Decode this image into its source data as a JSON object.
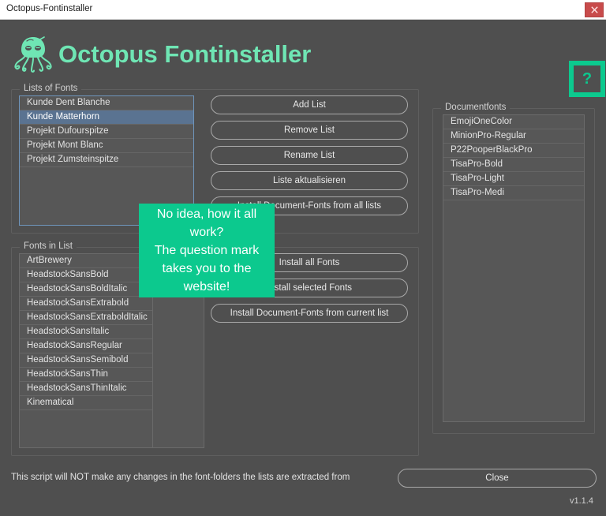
{
  "window": {
    "title": "Octopus-Fontinstaller",
    "close_icon": "close-icon"
  },
  "header": {
    "app_title": "Octopus Fontinstaller",
    "logo_icon": "octopus-logo-icon",
    "help_label": "?"
  },
  "colors": {
    "accent_green": "#0cc98e",
    "logo_green": "#6fe6b4",
    "window_bg": "#4f4f4f",
    "list_bg": "#575757",
    "selection": "#5a7391",
    "close_red": "#c84b4b"
  },
  "lists_of_fonts": {
    "group_title": "Lists of Fonts",
    "items": [
      {
        "label": "Kunde Dent Blanche",
        "selected": false
      },
      {
        "label": "Kunde Matterhorn",
        "selected": true
      },
      {
        "label": "Projekt Dufourspitze",
        "selected": false
      },
      {
        "label": "Projekt Mont Blanc",
        "selected": false
      },
      {
        "label": "Projekt Zumsteinspitze",
        "selected": false
      }
    ],
    "buttons": [
      "Add List",
      "Remove List",
      "Rename List",
      "Liste aktualisieren",
      "Install Document-Fonts from all lists"
    ]
  },
  "fonts_in_list": {
    "group_title": "Fonts in List",
    "items": [
      "ArtBrewery",
      "HeadstockSansBold",
      "HeadstockSansBoldItalic",
      "HeadstockSansExtrabold",
      "HeadstockSansExtraboldItalic",
      "HeadstockSansItalic",
      "HeadstockSansRegular",
      "HeadstockSansSemibold",
      "HeadstockSansThin",
      "HeadstockSansThinItalic",
      "Kinematical"
    ],
    "buttons": [
      "Install all Fonts",
      "Install selected Fonts",
      "Install Document-Fonts from current list"
    ]
  },
  "documentfonts": {
    "group_title": "Documentfonts",
    "items": [
      "EmojiOneColor",
      "MinionPro-Regular",
      "P22PooperBlackPro",
      "TisaPro-Bold",
      "TisaPro-Light",
      "TisaPro-Medi"
    ]
  },
  "footer": {
    "note": "This script will NOT make any changes in the font-folders the lists are extracted from",
    "close_label": "Close",
    "version": "v1.1.4"
  },
  "tooltip": {
    "line1": "No idea, how it all",
    "line2": "work?",
    "line3": "The question mark",
    "line4": "takes you to the",
    "line5": "website!"
  }
}
